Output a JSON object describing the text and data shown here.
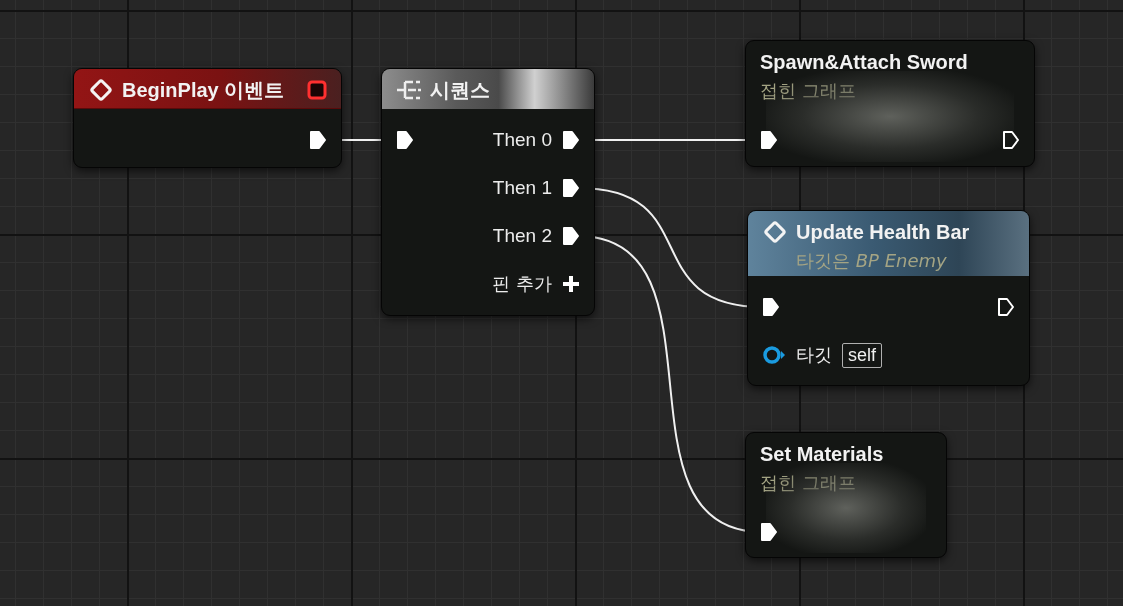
{
  "nodes": [
    {
      "kind": "event",
      "title": "BeginPlay 이벤트",
      "delegate_pin": {
        "connected": false
      },
      "outputs": [
        {
          "connected": true
        }
      ]
    },
    {
      "kind": "sequence",
      "title": "시퀀스",
      "input": {
        "connected": true
      },
      "outputs": [
        {
          "label": "Then 0",
          "connected": true
        },
        {
          "label": "Then 1",
          "connected": true
        },
        {
          "label": "Then 2",
          "connected": true
        }
      ],
      "add_pin_label": "핀 추가"
    },
    {
      "kind": "collapsed",
      "title": "Spawn&Attach Sword",
      "subtitle": "접힌 그래프",
      "input": {
        "connected": true
      },
      "outputs": [
        {
          "connected": false
        }
      ]
    },
    {
      "kind": "function",
      "title": "Update Health Bar",
      "subtitle": "타깃은 *BP Enemy*",
      "input": {
        "connected": true
      },
      "outputs": [
        {
          "connected": false
        }
      ],
      "params": [
        {
          "label": "타깃",
          "value": "self",
          "connected": false
        }
      ]
    },
    {
      "kind": "collapsed",
      "title": "Set Materials",
      "subtitle": "접힌 그래프",
      "input": {
        "connected": true
      }
    }
  ]
}
